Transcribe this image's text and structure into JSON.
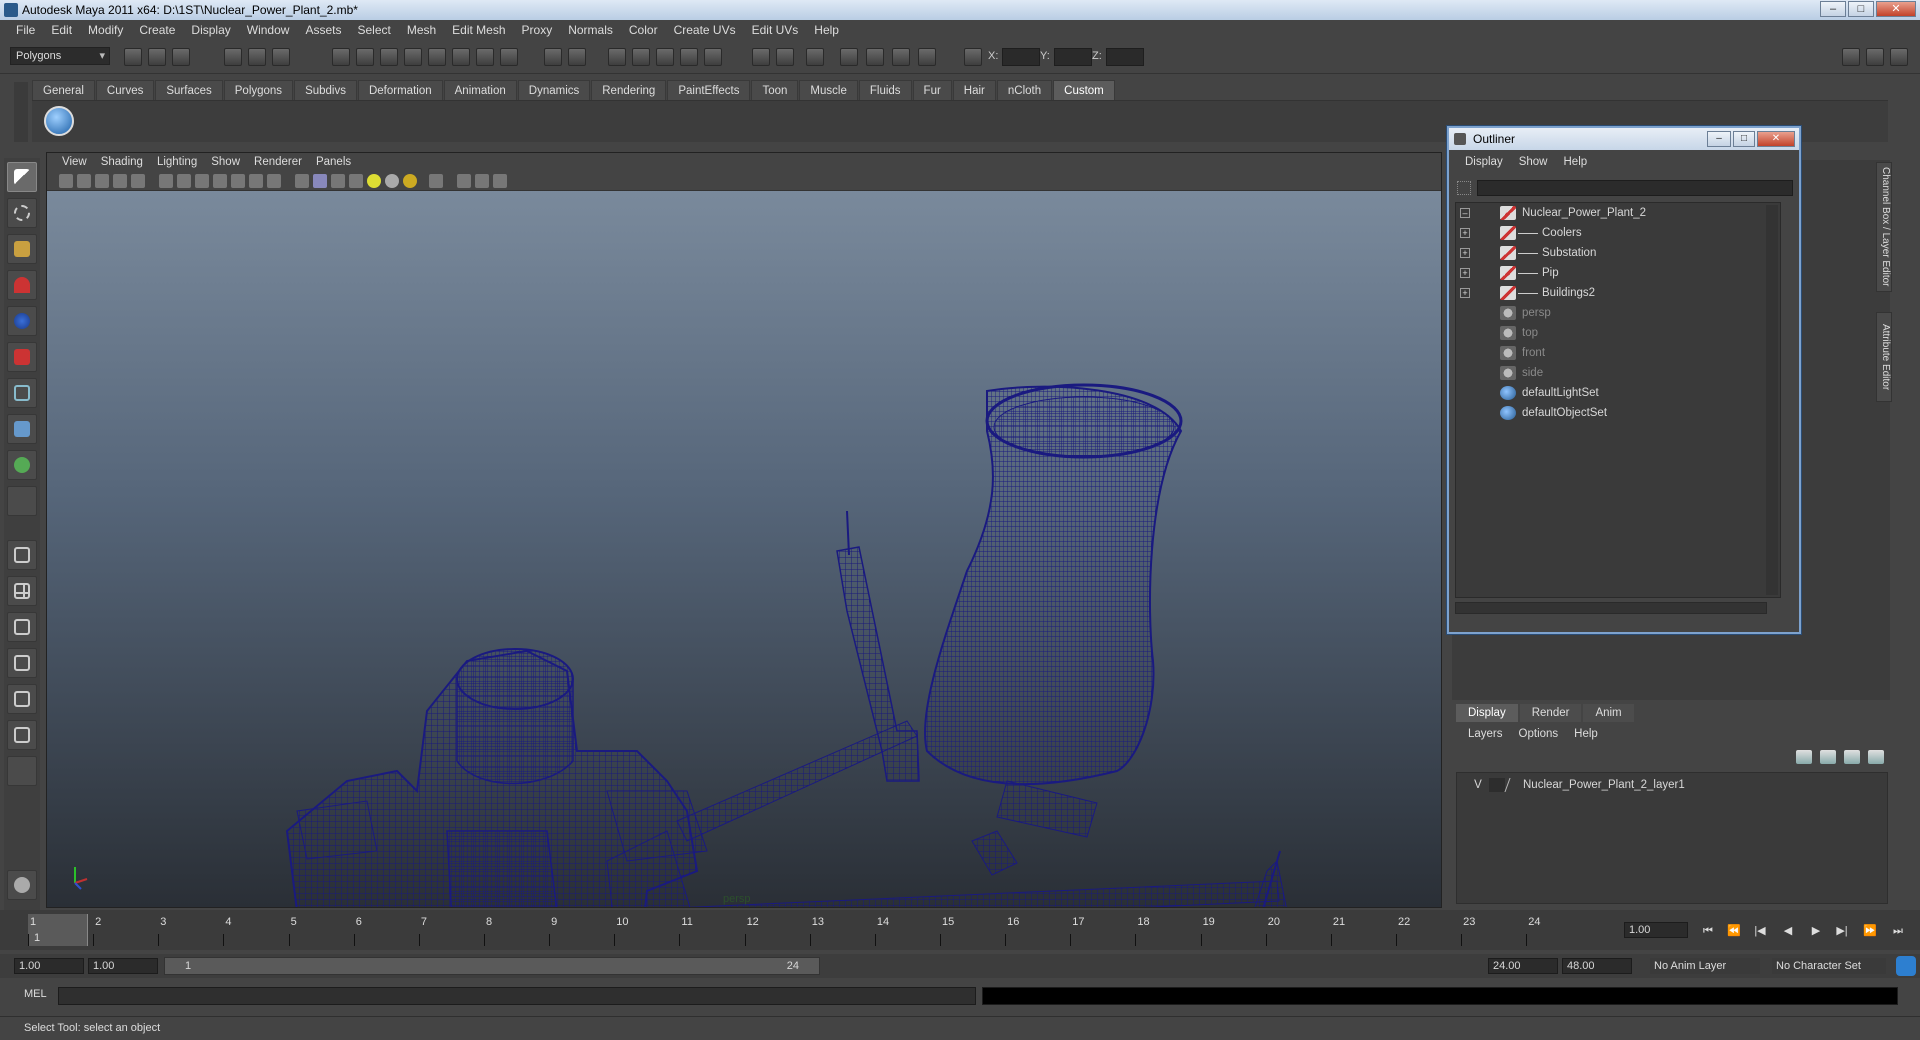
{
  "window": {
    "title": "Autodesk Maya 2011 x64: D:\\1ST\\Nuclear_Power_Plant_2.mb*",
    "buttons": {
      "minimize": "–",
      "maximize": "□",
      "close": "✕"
    }
  },
  "menubar": [
    "File",
    "Edit",
    "Modify",
    "Create",
    "Display",
    "Window",
    "Assets",
    "Select",
    "Mesh",
    "Edit Mesh",
    "Proxy",
    "Normals",
    "Color",
    "Create UVs",
    "Edit UVs",
    "Help"
  ],
  "statusline": {
    "mode": "Polygons",
    "x_label": "X:",
    "y_label": "Y:",
    "z_label": "Z:"
  },
  "shelf": {
    "tabs": [
      "General",
      "Curves",
      "Surfaces",
      "Polygons",
      "Subdivs",
      "Deformation",
      "Animation",
      "Dynamics",
      "Rendering",
      "PaintEffects",
      "Toon",
      "Muscle",
      "Fluids",
      "Fur",
      "Hair",
      "nCloth",
      "Custom"
    ],
    "active_tab": "Custom"
  },
  "viewport": {
    "menu": [
      "View",
      "Shading",
      "Lighting",
      "Show",
      "Renderer",
      "Panels"
    ],
    "camera_label": "persp",
    "wire_color": "#1a1a7a"
  },
  "outliner": {
    "title": "Outliner",
    "menu": [
      "Display",
      "Show",
      "Help"
    ],
    "items": [
      {
        "label": "Nuclear_Power_Plant_2",
        "type": "mesh",
        "expand": "–"
      },
      {
        "label": "Coolers",
        "type": "mesh",
        "expand": "+"
      },
      {
        "label": "Substation",
        "type": "mesh",
        "expand": "+"
      },
      {
        "label": "Pip",
        "type": "mesh",
        "expand": "+"
      },
      {
        "label": "Buildings2",
        "type": "mesh",
        "expand": "+"
      },
      {
        "label": "persp",
        "type": "camera"
      },
      {
        "label": "top",
        "type": "camera"
      },
      {
        "label": "front",
        "type": "camera"
      },
      {
        "label": "side",
        "type": "camera"
      },
      {
        "label": "defaultLightSet",
        "type": "set"
      },
      {
        "label": "defaultObjectSet",
        "type": "set"
      }
    ]
  },
  "side_tabs": [
    "Channel Box / Layer Editor",
    "Attribute Editor"
  ],
  "layer_editor": {
    "tabs": [
      "Display",
      "Render",
      "Anim"
    ],
    "active_tab": "Display",
    "menu": [
      "Layers",
      "Options",
      "Help"
    ],
    "layers": [
      {
        "visible": "V",
        "name": "Nuclear_Power_Plant_2_layer1"
      }
    ]
  },
  "timeline": {
    "frames": [
      "1",
      "2",
      "3",
      "4",
      "5",
      "6",
      "7",
      "8",
      "9",
      "10",
      "11",
      "12",
      "13",
      "14",
      "15",
      "16",
      "17",
      "18",
      "19",
      "20",
      "21",
      "22",
      "23",
      "24"
    ],
    "current_frame_marker": "1",
    "current_time": "1.00"
  },
  "range": {
    "start": "1.00",
    "playback_start": "1.00",
    "slider_start": "1",
    "slider_end": "24",
    "playback_end": "24.00",
    "end": "48.00",
    "anim_layer": "No Anim Layer",
    "character_set": "No Character Set"
  },
  "command_line": {
    "label": "MEL"
  },
  "help_line": "Select Tool: select an object"
}
